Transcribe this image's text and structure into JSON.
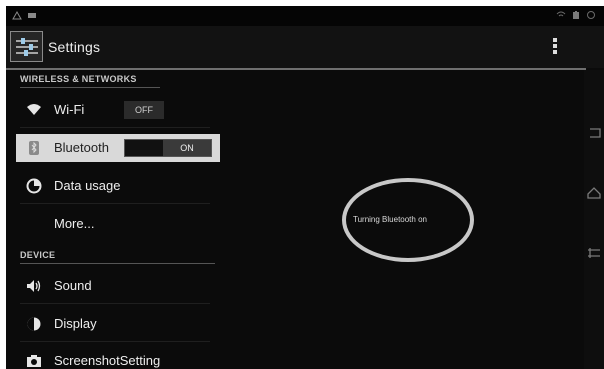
{
  "header": {
    "title": "Settings"
  },
  "sections": {
    "wireless_header": "WIRELESS & NETWORKS",
    "device_header": "DEVICE"
  },
  "items": {
    "wifi": {
      "label": "Wi-Fi",
      "toggle": "OFF",
      "icon": "wifi-icon"
    },
    "bluetooth": {
      "label": "Bluetooth",
      "toggle": "ON",
      "icon": "bluetooth-icon"
    },
    "data_usage": {
      "label": "Data usage",
      "icon": "data-usage-icon"
    },
    "more": {
      "label": "More..."
    },
    "sound": {
      "label": "Sound",
      "icon": "sound-icon"
    },
    "display": {
      "label": "Display",
      "icon": "display-icon"
    },
    "screenshot": {
      "label": "ScreenshotSetting",
      "icon": "camera-icon"
    }
  },
  "toast": {
    "text": "Turning Bluetooth on"
  },
  "colors": {
    "background": "#0b0b0b",
    "highlight_row": "#d9d9d9",
    "annotation_ring": "#c8c8c8"
  }
}
